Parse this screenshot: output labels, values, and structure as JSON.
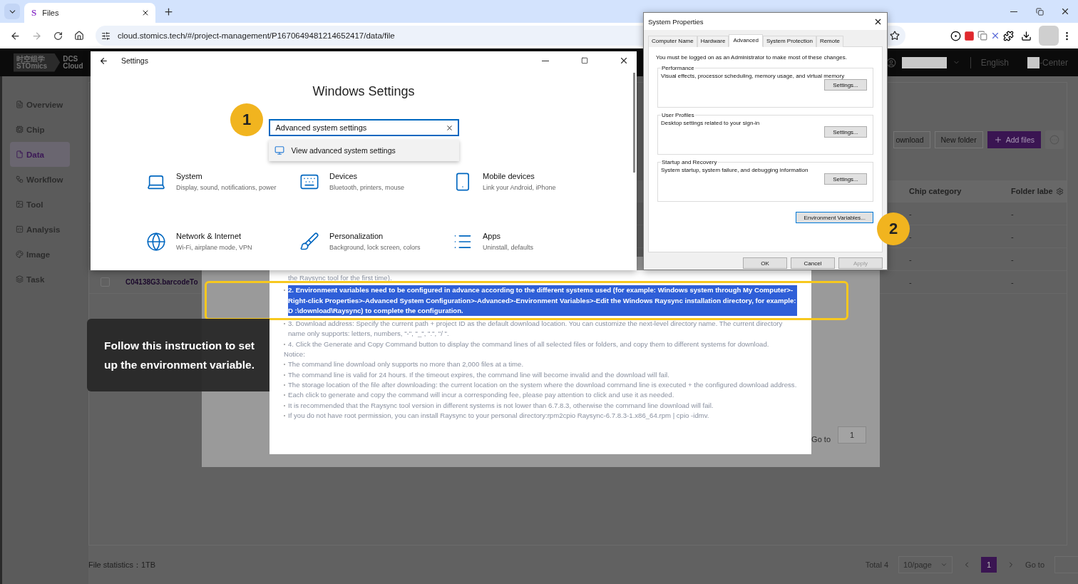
{
  "browser": {
    "tabs": [
      {
        "favicon": "S",
        "title": "Files",
        "selected": true
      }
    ],
    "address": "cloud.stomics.tech/#/project-management/P1670649481214652417/data/file"
  },
  "app": {
    "logo": {
      "chinese": "时空组学",
      "latin": "STOmics",
      "product": "DCS",
      "product_sub": "Cloud"
    },
    "header": {
      "language": "English",
      "center": "-Center"
    },
    "sidebar": [
      {
        "label": "Overview",
        "selected": false
      },
      {
        "label": "Chip",
        "selected": false
      },
      {
        "label": "Data",
        "selected": true
      },
      {
        "label": "Workflow",
        "selected": false
      },
      {
        "label": "Tool",
        "selected": false
      },
      {
        "label": "Analysis",
        "selected": false
      },
      {
        "label": "Image",
        "selected": false
      },
      {
        "label": "Task",
        "selected": false
      }
    ],
    "toolbar": [
      {
        "label": "ownload",
        "kind": "outline"
      },
      {
        "label": "New folder",
        "kind": "outline"
      },
      {
        "label": "Add files",
        "kind": "primary"
      }
    ],
    "table": {
      "columns": [
        "Chip category",
        "Folder labe"
      ],
      "rows": [
        {
          "cells": [
            "-",
            "-"
          ]
        },
        {
          "cells": [
            "-",
            "-"
          ]
        },
        {
          "cells": [
            "-",
            "-"
          ]
        },
        {
          "file": {
            "name": "C04138G3.barcodeTo",
            "checked": false
          },
          "cells": [
            "-",
            "-"
          ]
        }
      ]
    },
    "footer": {
      "statistics": "File statistics：1TB",
      "total": "Total 4",
      "page_size": "10/page",
      "pages": [
        {
          "label": "1",
          "selected": true
        }
      ],
      "goto": "Go to"
    }
  },
  "download_dialog": {
    "items": [
      {
        "kind": "tail",
        "text": "the Raysync tool for the first time).",
        "selected": false
      },
      {
        "kind": "bullet",
        "text": "2. Environment variables need to be configured in advance according to the different systems used (for example: Windows system through My Computer>-Right-click Properties>-Advanced System Configuration>-Advanced>-Environment Variables>-Edit the Windows Raysync installation directory, for example: D :\\download\\Raysync) to complete the configuration.",
        "selected": true
      },
      {
        "kind": "bullet",
        "text": "3. Download address: Specify the current path + project ID as the default download location. You can customize the next-level directory name. The current directory name only supports: letters, numbers, \"-\", \"_\", \".\", \"/ \".",
        "selected": false
      },
      {
        "kind": "bullet",
        "text": "4. Click the Generate and Copy Command button to display the command lines of all selected files or folders, and copy them to different systems for download.",
        "selected": false
      },
      {
        "kind": "heading",
        "text": "Notice:",
        "selected": false
      },
      {
        "kind": "bullet",
        "text": "The command line download only supports no more than 2,000 files at a time.",
        "selected": false
      },
      {
        "kind": "bullet",
        "text": "The command line is valid for 24 hours. If the timeout expires, the command line will become invalid and the download will fail.",
        "selected": false
      },
      {
        "kind": "bullet",
        "text": "The storage location of the file after downloading: the current location on the system where the download command line is executed + the configured download address.",
        "selected": false
      },
      {
        "kind": "bullet",
        "text": "Each click to generate and copy the command will incur a corresponding fee, please pay attention to click and use it as needed.",
        "selected": false
      },
      {
        "kind": "bullet",
        "text": "It is recommended that the Raysync tool version in different systems is not lower than 6.7.8.3, otherwise the command line download will fail.",
        "selected": false
      },
      {
        "kind": "bullet",
        "text": "If you do not have root permission, you can install Raysync to your personal directory:rpm2cpio Raysync-6.7.8.3-1.x86_64.rpm | cpio -idmv.",
        "selected": false
      }
    ],
    "goto": "Go to",
    "goto_value": "1"
  },
  "tooltip": "Follow this instruction to set up the environment variable.",
  "settings_window": {
    "title": "Settings",
    "heading": "Windows Settings",
    "search": {
      "value": "Advanced system settings"
    },
    "suggestions": [
      "View advanced system settings"
    ],
    "categories": [
      {
        "title": "System",
        "subtitle": "Display, sound, notifications, power"
      },
      {
        "title": "Devices",
        "subtitle": "Bluetooth, printers, mouse"
      },
      {
        "title": "Mobile devices",
        "subtitle": "Link your Android, iPhone"
      },
      {
        "title": "Network & Internet",
        "subtitle": "Wi-Fi, airplane mode, VPN"
      },
      {
        "title": "Personalization",
        "subtitle": "Background, lock screen, colors"
      },
      {
        "title": "Apps",
        "subtitle": "Uninstall, defaults"
      }
    ]
  },
  "system_properties": {
    "title": "System Properties",
    "tabs": [
      {
        "label": "Computer Name",
        "selected": false
      },
      {
        "label": "Hardware",
        "selected": false
      },
      {
        "label": "Advanced",
        "selected": true
      },
      {
        "label": "System Protection",
        "selected": false
      },
      {
        "label": "Remote",
        "selected": false
      }
    ],
    "notice": "You must be logged on as an Administrator to make most of these changes.",
    "groups": [
      {
        "legend": "Performance",
        "description": "Visual effects, processor scheduling, memory usage, and virtual memory",
        "button": "Settings..."
      },
      {
        "legend": "User Profiles",
        "description": "Desktop settings related to your sign-in",
        "button": "Settings..."
      },
      {
        "legend": "Startup and Recovery",
        "description": "System startup, system failure, and debugging information",
        "button": "Settings..."
      }
    ],
    "env_button": "Environment Variables...",
    "buttons": [
      {
        "label": "OK",
        "disabled": false
      },
      {
        "label": "Cancel",
        "disabled": false
      },
      {
        "label": "Apply",
        "disabled": true
      }
    ]
  },
  "callouts": [
    "1",
    "2"
  ]
}
